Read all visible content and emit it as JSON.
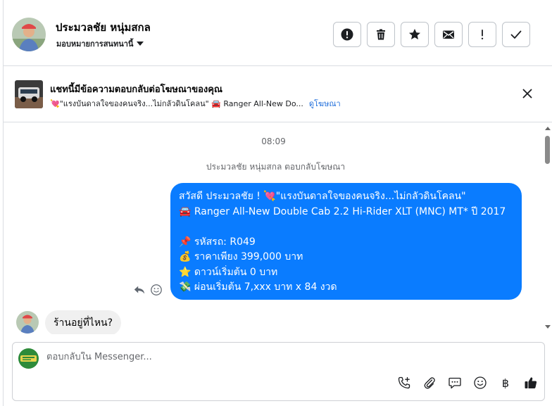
{
  "header": {
    "contact_name": "ประมวลชัย หนุ่มสกล",
    "assign_label": "มอบหมายการสนทนานี้",
    "toolbar": [
      "report-icon",
      "trash-icon",
      "star-icon",
      "envelope-icon",
      "exclamation-icon",
      "check-icon"
    ]
  },
  "ad_banner": {
    "title": "แชทนี้มีข้อความตอบกลับต่อโฆษณาของคุณ",
    "subtitle": "💘\"แรงบันดาลใจของคนจริง...ไม่กลัวดินโคลน\" 🚘 Ranger All-New Do...",
    "link_label": "ดูโฆษณา"
  },
  "thread": {
    "timestamp": "08:09",
    "reply_note": "ประมวลชัย หนุ่มสกล ตอบกลับโฆษณา",
    "outgoing_message": {
      "lines": [
        "สวัสดี ประมวลชัย ! 💘\"แรงบันดาลใจของคนจริง...ไม่กลัวดินโคลน\"",
        "🚘 Ranger All-New Double Cab 2.2 Hi-Rider XLT (MNC) MT* ปี 2017",
        "",
        "📌 รหัสรถ: R049",
        "💰 ราคาเพียง 399,000 บาท",
        "⭐ ดาวน์เริ่มต้น 0 บาท",
        "💸 ผ่อนเริ่มต้น 7,xxx บาท x 84 งวด"
      ]
    },
    "incoming_message": "ร้านอยู่ที่ไหน?"
  },
  "composer": {
    "placeholder": "ตอบกลับใน Messenger...",
    "tools": [
      "phone-plus-icon",
      "paperclip-icon",
      "saved-reply-icon",
      "emoji-icon",
      "baht-icon",
      "thumbs-up-icon"
    ],
    "baht_symbol": "฿"
  },
  "colors": {
    "accent": "#0a7cff",
    "link": "#216fdb",
    "incoming_bubble": "#f0f0f0",
    "muted_text": "#65676b"
  }
}
